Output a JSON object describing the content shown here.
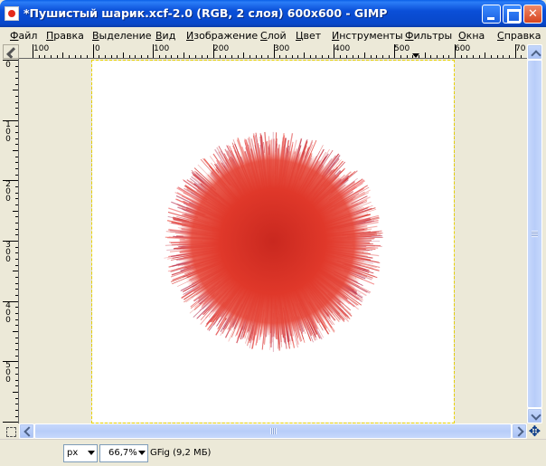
{
  "window": {
    "title": "*Пушистый шарик.xcf-2.0 (RGB, 2 слоя) 600x600 - GIMP",
    "app_icon": "gimp-wilber-icon"
  },
  "menu": {
    "items": [
      {
        "label": "Файл"
      },
      {
        "label": "Правка"
      },
      {
        "label": "Выделение"
      },
      {
        "label": "Вид"
      },
      {
        "label": "Изображение"
      },
      {
        "label": "Слой"
      },
      {
        "label": "Цвет"
      },
      {
        "label": "Инструменты"
      },
      {
        "label": "Фильтры"
      },
      {
        "label": "Окна"
      },
      {
        "label": "Справка"
      }
    ]
  },
  "rulers": {
    "horizontal_labels": [
      "100",
      "0",
      "100",
      "200",
      "300",
      "400",
      "500",
      "600",
      "70"
    ],
    "vertical_labels": [
      "0",
      "100",
      "200",
      "300",
      "400",
      "500"
    ]
  },
  "canvas": {
    "image_background": "#ffffff",
    "object": "fluffy-red-ball",
    "object_color": "#e0382a",
    "selection_border": "dashed-marching-ants"
  },
  "statusbar": {
    "unit": "px",
    "zoom": "66,7%",
    "info": "GFig (9,2 МБ)"
  }
}
